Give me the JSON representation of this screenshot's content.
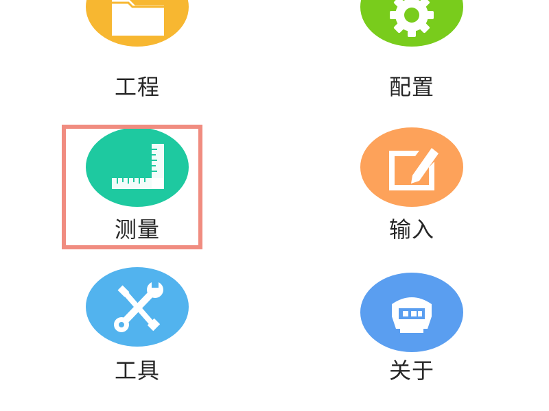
{
  "menu": {
    "items": [
      {
        "label": "工程",
        "icon": "folder-icon",
        "color": "#f7b731"
      },
      {
        "label": "配置",
        "icon": "gear-icon",
        "color": "#79cc1c"
      },
      {
        "label": "测量",
        "icon": "ruler-icon",
        "color": "#1ec9a0"
      },
      {
        "label": "输入",
        "icon": "edit-icon",
        "color": "#fda25a"
      },
      {
        "label": "工具",
        "icon": "tools-icon",
        "color": "#52b3ee"
      },
      {
        "label": "关于",
        "icon": "device-icon",
        "color": "#5a9ef0"
      }
    ],
    "selected": "测量",
    "highlight_color": "#f08c80"
  }
}
